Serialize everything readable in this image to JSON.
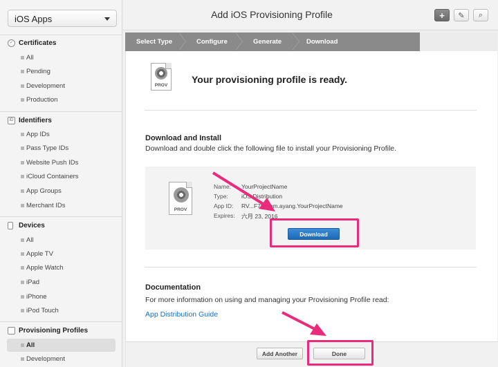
{
  "sidebar": {
    "app_select": "iOS Apps",
    "sections": [
      {
        "title": "Certificates",
        "icon": "certificate-icon",
        "items": [
          "All",
          "Pending",
          "Development",
          "Production"
        ]
      },
      {
        "title": "Identifiers",
        "icon": "id-badge-icon",
        "icon_text": "ID",
        "items": [
          "App IDs",
          "Pass Type IDs",
          "Website Push IDs",
          "iCloud Containers",
          "App Groups",
          "Merchant IDs"
        ]
      },
      {
        "title": "Devices",
        "icon": "device-icon",
        "items": [
          "All",
          "Apple TV",
          "Apple Watch",
          "iPad",
          "iPhone",
          "iPod Touch"
        ]
      },
      {
        "title": "Provisioning Profiles",
        "icon": "profile-icon",
        "items": [
          "All",
          "Development"
        ],
        "active": "All"
      }
    ]
  },
  "header": {
    "title": "Add iOS Provisioning Profile",
    "buttons": [
      {
        "name": "add-icon",
        "glyph": "+"
      },
      {
        "name": "edit-icon",
        "glyph": "✎"
      },
      {
        "name": "search-icon",
        "glyph": "⌕"
      }
    ]
  },
  "steps": [
    "Select Type",
    "Configure",
    "Generate",
    "Download"
  ],
  "main": {
    "ready_text": "Your provisioning profile is ready.",
    "prov_label": "PROV",
    "download_heading": "Download and Install",
    "download_text": "Download and double click the following file to install your Provisioning Profile.",
    "file": {
      "name_label": "Name:",
      "name_value": "YourProjectName",
      "type_label": "Type:",
      "type_value": "iOS Distribution",
      "appid_label": "App ID:",
      "appid_value": "RV...F7R.com.ayang.YourProjectName",
      "expires_label": "Expires:",
      "expires_value": "六月 23, 2016"
    },
    "download_button": "Download",
    "doc_heading": "Documentation",
    "doc_text": "For more information on using and managing your Provisioning Profile read:",
    "doc_link": "App Distribution Guide"
  },
  "footer": {
    "add_another": "Add Another",
    "done": "Done"
  },
  "colors": {
    "highlight": "#ea2a7a",
    "download_button": "#2a78c6",
    "link": "#1a6fc2"
  }
}
